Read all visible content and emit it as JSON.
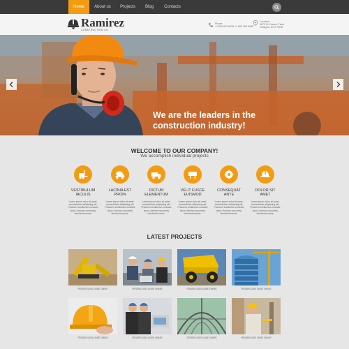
{
  "nav": {
    "items": [
      {
        "label": "Home",
        "active": true
      },
      {
        "label": "About us",
        "active": false
      },
      {
        "label": "Projects",
        "active": false
      },
      {
        "label": "Blog",
        "active": false
      },
      {
        "label": "Contacts",
        "active": false
      }
    ],
    "search_icon": "search-icon"
  },
  "header": {
    "logo_title": "Ramirez",
    "logo_subtitle": "CONSTRUCTION CO",
    "phone_label": "Phone:",
    "phone_value": "+1 800 603 6035 +1 800 559 6580",
    "location_label": "Location:",
    "location_line1": "9870 St Vincent Place",
    "location_line2": "Glasgow, DC4 78GR"
  },
  "hero": {
    "headline_line1": "We are the leaders in the",
    "headline_line2": "construction industry!"
  },
  "welcome": {
    "title": "WELCOME TO OUR COMPANY!",
    "subtitle": "We accomplish individual projects",
    "features": [
      {
        "title_1": "VESTIBULUM",
        "title_2": "IACULIS",
        "icon": "forklift-icon"
      },
      {
        "title_1": "LACINIA EST",
        "title_2": "PROIN",
        "icon": "concrete-mixer-icon"
      },
      {
        "title_1": "DICTUM",
        "title_2": "ELEMENTUM",
        "icon": "truck-icon"
      },
      {
        "title_1": "VELIT FUSCE",
        "title_2": "EUISMOD",
        "icon": "sign-icon"
      },
      {
        "title_1": "CONSEQUAT",
        "title_2": "ANTE",
        "icon": "saw-icon"
      },
      {
        "title_1": "DOLOR SIT",
        "title_2": "AMET",
        "icon": "helmet-icon"
      }
    ],
    "feature_text_1": "Lorem ipsum dolor sit amet,",
    "feature_text_2": "consectetuer adipiscing elit.",
    "feature_text_3": "Praesent vestibulum molestie",
    "feature_text_4": "lacus. Aenean nonummy",
    "feature_text_5": "hendrerit mauris."
  },
  "projects": {
    "title": "LATEST PROJECTS",
    "caption": "FENDRICUDIS UNDE OMNIS",
    "items": [
      {
        "kind": "excavator"
      },
      {
        "kind": "team-laptop"
      },
      {
        "kind": "dump-truck"
      },
      {
        "kind": "tower-crane"
      },
      {
        "kind": "helmet"
      },
      {
        "kind": "engineers"
      },
      {
        "kind": "glass-roof"
      },
      {
        "kind": "worker-measuring"
      }
    ]
  },
  "colors": {
    "accent": "#f39c12",
    "nav_bg": "#3a3a3a",
    "page_bg": "#e6e6e6"
  }
}
